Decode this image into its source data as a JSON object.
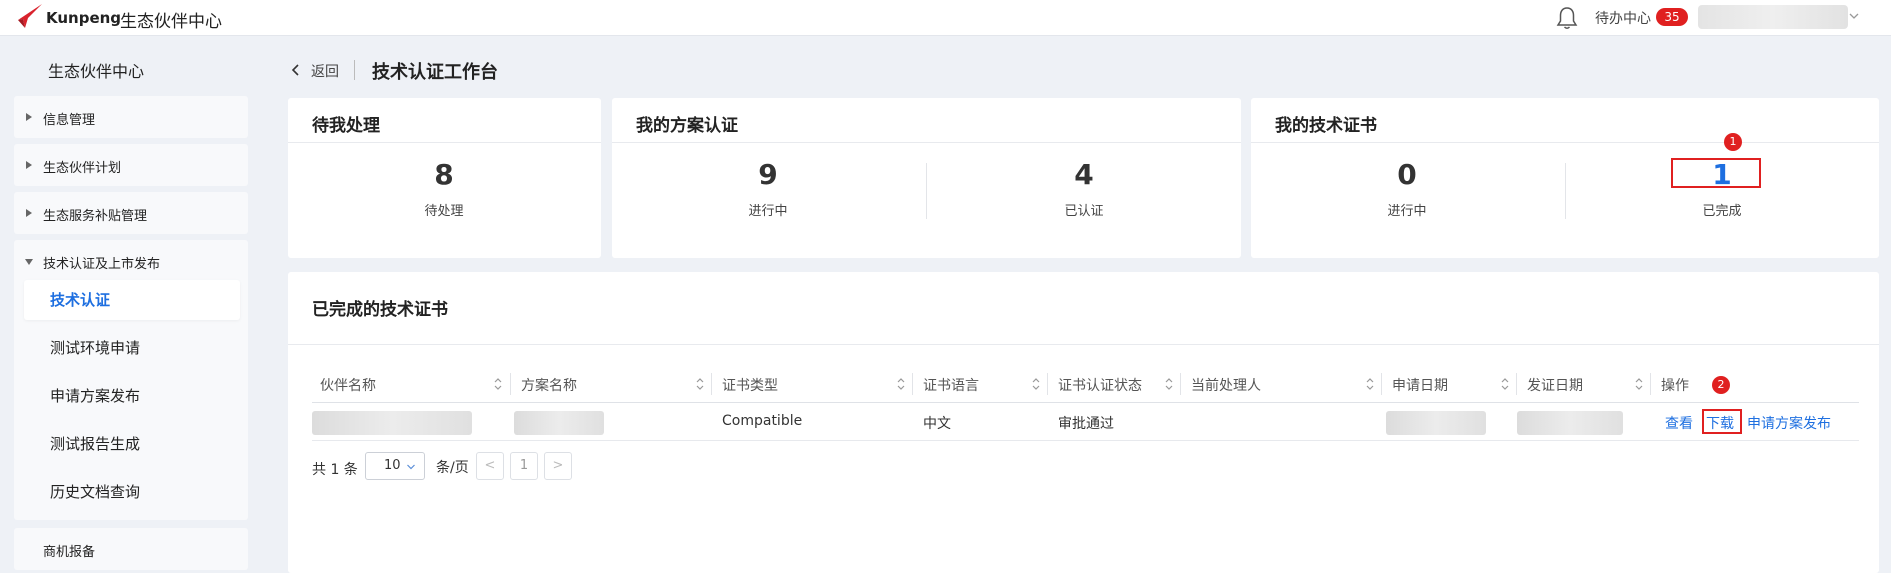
{
  "topbar": {
    "logo_text": "Kunpeng",
    "app_title": "生态伙伴中心",
    "todo_label": "待办中心",
    "todo_count": "35",
    "logo_color": "#d9232d"
  },
  "sidebar": {
    "title": "生态伙伴中心",
    "groups": [
      {
        "label": "信息管理"
      },
      {
        "label": "生态伙伴计划"
      },
      {
        "label": "生态服务补贴管理"
      },
      {
        "label": "技术认证及上市发布"
      },
      {
        "label": "商机报备"
      }
    ],
    "sub_items": [
      {
        "label": "技术认证",
        "active": true
      },
      {
        "label": "测试环境申请"
      },
      {
        "label": "申请方案发布"
      },
      {
        "label": "测试报告生成"
      },
      {
        "label": "历史文档查询"
      }
    ]
  },
  "header": {
    "back_label": "返回",
    "page_title": "技术认证工作台"
  },
  "cards": {
    "pending": {
      "title": "待我处理",
      "stats": [
        {
          "value": "8",
          "label": "待处理"
        }
      ]
    },
    "solutions": {
      "title": "我的方案认证",
      "stats": [
        {
          "value": "9",
          "label": "进行中"
        },
        {
          "value": "4",
          "label": "已认证"
        }
      ]
    },
    "certs": {
      "title": "我的技术证书",
      "stats": [
        {
          "value": "0",
          "label": "进行中"
        },
        {
          "value": "1",
          "label": "已完成"
        }
      ]
    }
  },
  "annotations": {
    "marker1": "1",
    "marker2": "2",
    "color": "#e02020"
  },
  "panel": {
    "title": "已完成的技术证书",
    "columns": [
      "伙伴名称",
      "方案名称",
      "证书类型",
      "证书语言",
      "证书认证状态",
      "当前处理人",
      "申请日期",
      "发证日期",
      "操作"
    ],
    "rows": [
      {
        "cert_type": "Compatible",
        "language": "中文",
        "status": "审批通过",
        "actions": [
          "查看",
          "下载",
          "申请方案发布"
        ]
      }
    ],
    "pager": {
      "total": "共 1 条",
      "page_size": "10",
      "per_page": "条/页",
      "prev": "<",
      "current": "1",
      "next": ">"
    }
  },
  "colors": {
    "accent": "#1e6fe0",
    "background": "#eef1f6"
  }
}
